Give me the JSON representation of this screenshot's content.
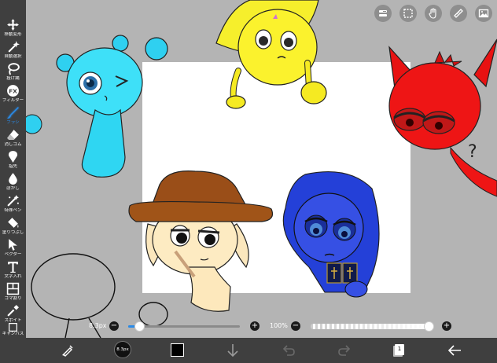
{
  "left_toolbar": {
    "tools": [
      {
        "label": "移動変形",
        "icon": "move-transform-icon"
      },
      {
        "label": "自動選択",
        "icon": "magic-wand-icon"
      },
      {
        "label": "投げ縄",
        "icon": "lasso-icon"
      },
      {
        "label": "フィルター",
        "icon": "fx-filter-icon"
      },
      {
        "label": "ブラシ",
        "icon": "brush-icon",
        "active": true
      },
      {
        "label": "消しゴム",
        "icon": "eraser-icon"
      },
      {
        "label": "指先",
        "icon": "finger-smudge-icon"
      },
      {
        "label": "ぼかし",
        "icon": "blur-drop-icon"
      },
      {
        "label": "特殊ペン",
        "icon": "special-pen-icon"
      },
      {
        "label": "塗りつぶし",
        "icon": "bucket-fill-icon"
      },
      {
        "label": "ベクター",
        "icon": "vector-cursor-icon"
      },
      {
        "label": "文字入れ",
        "icon": "text-t-icon"
      },
      {
        "label": "コマ割り",
        "icon": "panel-divide-icon"
      },
      {
        "label": "スポイト",
        "icon": "eyedropper-icon"
      },
      {
        "label": "キャンバス",
        "icon": "canvas-icon"
      }
    ]
  },
  "top_toolbar": {
    "buttons": [
      {
        "icon": "layer-toggle-icon"
      },
      {
        "icon": "selection-icon"
      },
      {
        "icon": "hand-icon"
      },
      {
        "icon": "ruler-icon"
      },
      {
        "icon": "image-icon"
      }
    ]
  },
  "brush_size": {
    "value_text": "8.3px",
    "minus": "−",
    "plus": "+",
    "level": 0.1
  },
  "opacity": {
    "value_text": "100%",
    "minus": "−",
    "plus": "+",
    "level": 1.0
  },
  "bottom_toolbar": {
    "brush_preview_label": "8.3px",
    "color": "#000000",
    "layer_count": "1"
  },
  "colors": {
    "toolbar_bg": "#3f3f3f",
    "workspace_bg": "#b4b4b4",
    "accent": "#2a8be8"
  }
}
